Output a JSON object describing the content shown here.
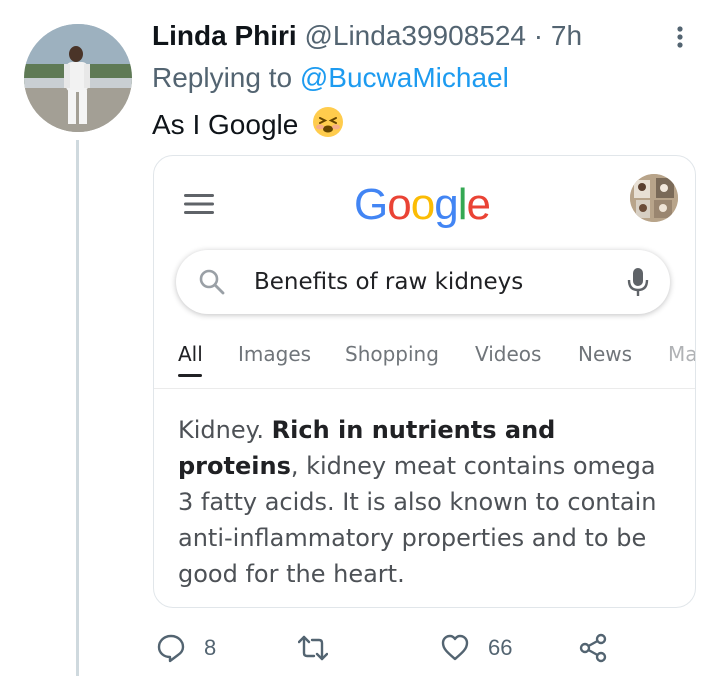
{
  "tweet": {
    "author_name": "Linda Phiri",
    "handle": "@Linda39908524",
    "separator": "·",
    "time": "7h",
    "replying_prefix": "Replying to",
    "replying_to": "@BucwaMichael",
    "text": "As I Google"
  },
  "google_card": {
    "logo_letters": [
      "G",
      "o",
      "o",
      "g",
      "l",
      "e"
    ],
    "logo_colors": [
      "#4285F4",
      "#EA4335",
      "#FBBC05",
      "#4285F4",
      "#34A853",
      "#EA4335"
    ],
    "search_query": "Benefits of raw kidneys",
    "tabs": [
      {
        "label": "All",
        "active": true
      },
      {
        "label": "Images",
        "active": false
      },
      {
        "label": "Shopping",
        "active": false
      },
      {
        "label": "Videos",
        "active": false
      },
      {
        "label": "News",
        "active": false
      },
      {
        "label": "Ma",
        "active": false
      }
    ],
    "snippet": {
      "lead": "Kidney. ",
      "bold": "Rich in nutrients and proteins",
      "rest": ", kidney meat contains omega 3 fatty acids. It is also known to contain anti-inflammatory properties and to be good for the heart."
    }
  },
  "actions": {
    "reply_count": "8",
    "retweet_count": "",
    "like_count": "66"
  },
  "colors": {
    "link": "#1d9bf0",
    "muted": "#536471"
  }
}
